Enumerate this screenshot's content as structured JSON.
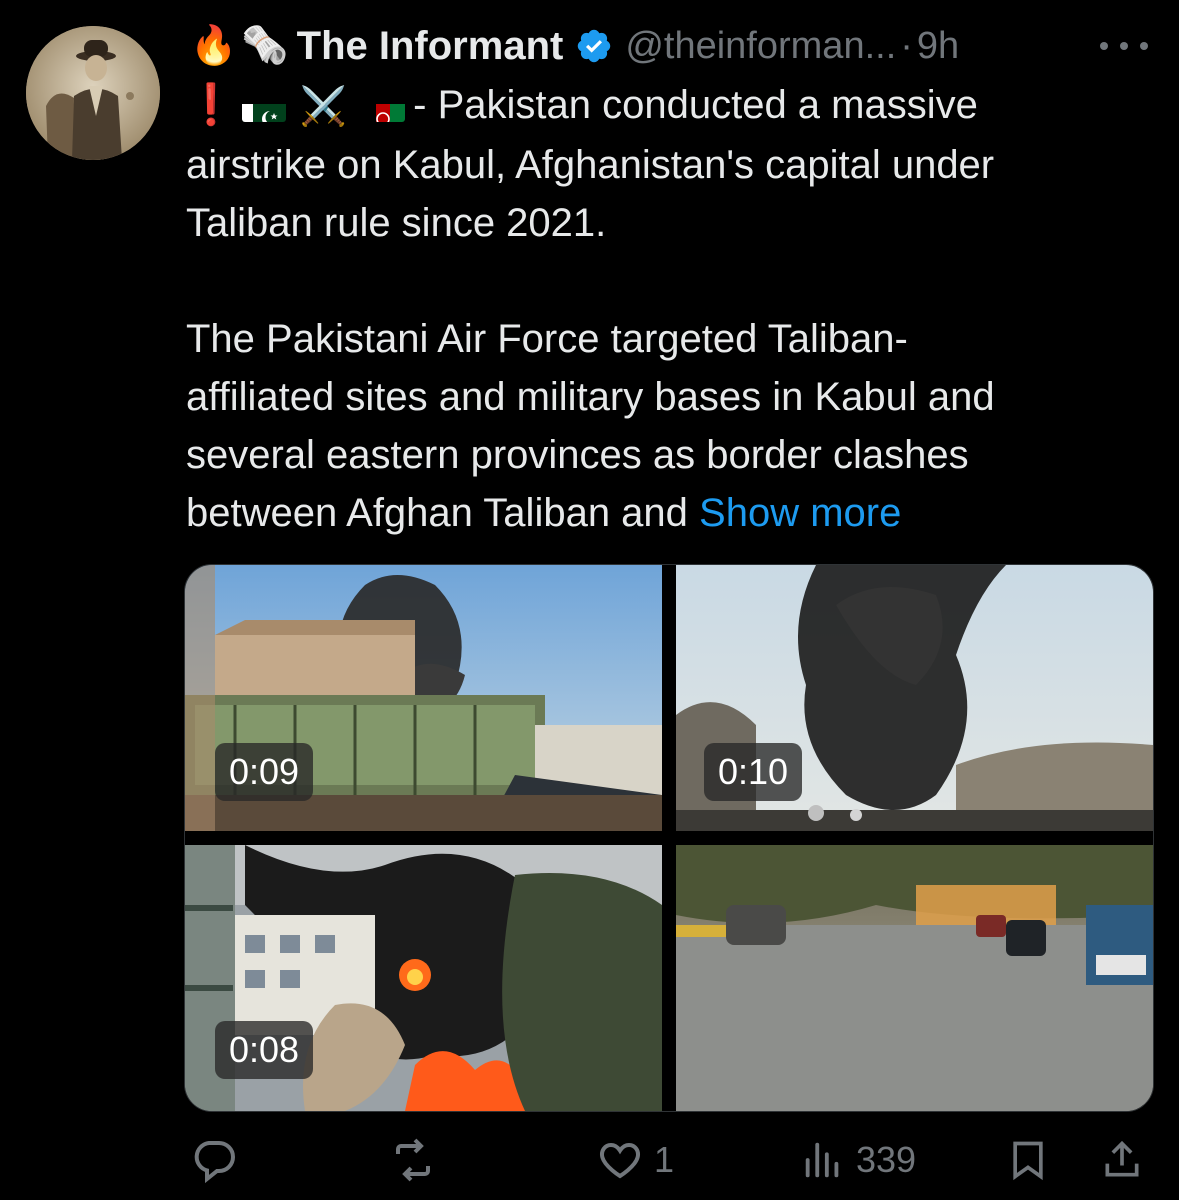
{
  "author": {
    "display_name": "The Informant",
    "handle": "@theinforman...",
    "separator": "·",
    "time": "9h",
    "name_emojis": [
      "🔥",
      "🗞️"
    ],
    "verified_color": "#1d9bf0"
  },
  "tweet": {
    "prefix_emoji": "❗",
    "prefix_rest": "- Pakistan conducted a massive",
    "line1b": "airstrike on Kabul, Afghanistan's capital under",
    "line1c": "Taliban rule since 2021.",
    "para2_l1": "The Pakistani Air Force targeted Taliban-",
    "para2_l2": "affiliated sites and military bases in Kabul and",
    "para2_l3": "several eastern provinces as border clashes",
    "para2_l4": "between Afghan Taliban and",
    "show_more": "Show more",
    "crossed_swords": "⚔️"
  },
  "media": [
    {
      "duration": "0:09"
    },
    {
      "duration": "0:10"
    },
    {
      "duration": "0:08"
    },
    {
      "duration": ""
    }
  ],
  "actions": {
    "replies": "",
    "reposts": "",
    "likes": "1",
    "views": "339"
  },
  "colors": {
    "background": "#000000",
    "text": "#e7e9ea",
    "secondary": "#71767b",
    "link": "#1d9bf0"
  }
}
